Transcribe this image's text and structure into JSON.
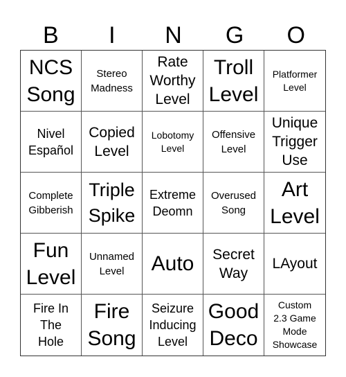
{
  "header": {
    "letters": [
      "B",
      "I",
      "N",
      "G",
      "O"
    ]
  },
  "cells": [
    {
      "text": "NCS\nSong",
      "size": "xl"
    },
    {
      "text": "Stereo\nMadness",
      "size": "s"
    },
    {
      "text": "Rate\nWorthy\nLevel",
      "size": "m"
    },
    {
      "text": "Troll\nLevel",
      "size": "xl"
    },
    {
      "text": "Platformer\nLevel",
      "size": "xs"
    },
    {
      "text": "Nivel\nEspañol",
      "size": "ms"
    },
    {
      "text": "Copied\nLevel",
      "size": "m"
    },
    {
      "text": "Lobotomy\nLevel",
      "size": "xs"
    },
    {
      "text": "Offensive\nLevel",
      "size": "s"
    },
    {
      "text": "Unique\nTrigger\nUse",
      "size": "m"
    },
    {
      "text": "Complete\nGibberish",
      "size": "s"
    },
    {
      "text": "Triple\nSpike",
      "size": "l"
    },
    {
      "text": "Extreme\nDeomn",
      "size": "ms"
    },
    {
      "text": "Overused\nSong",
      "size": "s"
    },
    {
      "text": "Art\nLevel",
      "size": "xl"
    },
    {
      "text": "Fun\nLevel",
      "size": "xl"
    },
    {
      "text": "Unnamed\nLevel",
      "size": "s"
    },
    {
      "text": "Auto",
      "size": "xl"
    },
    {
      "text": "Secret\nWay",
      "size": "m"
    },
    {
      "text": "LAyout",
      "size": "m"
    },
    {
      "text": "Fire In\nThe\nHole",
      "size": "ms"
    },
    {
      "text": "Fire\nSong",
      "size": "xl"
    },
    {
      "text": "Seizure\nInducing\nLevel",
      "size": "ms"
    },
    {
      "text": "Good\nDeco",
      "size": "xl"
    },
    {
      "text": "Custom\n2.3 Game\nMode\nShowcase",
      "size": "xs"
    }
  ]
}
